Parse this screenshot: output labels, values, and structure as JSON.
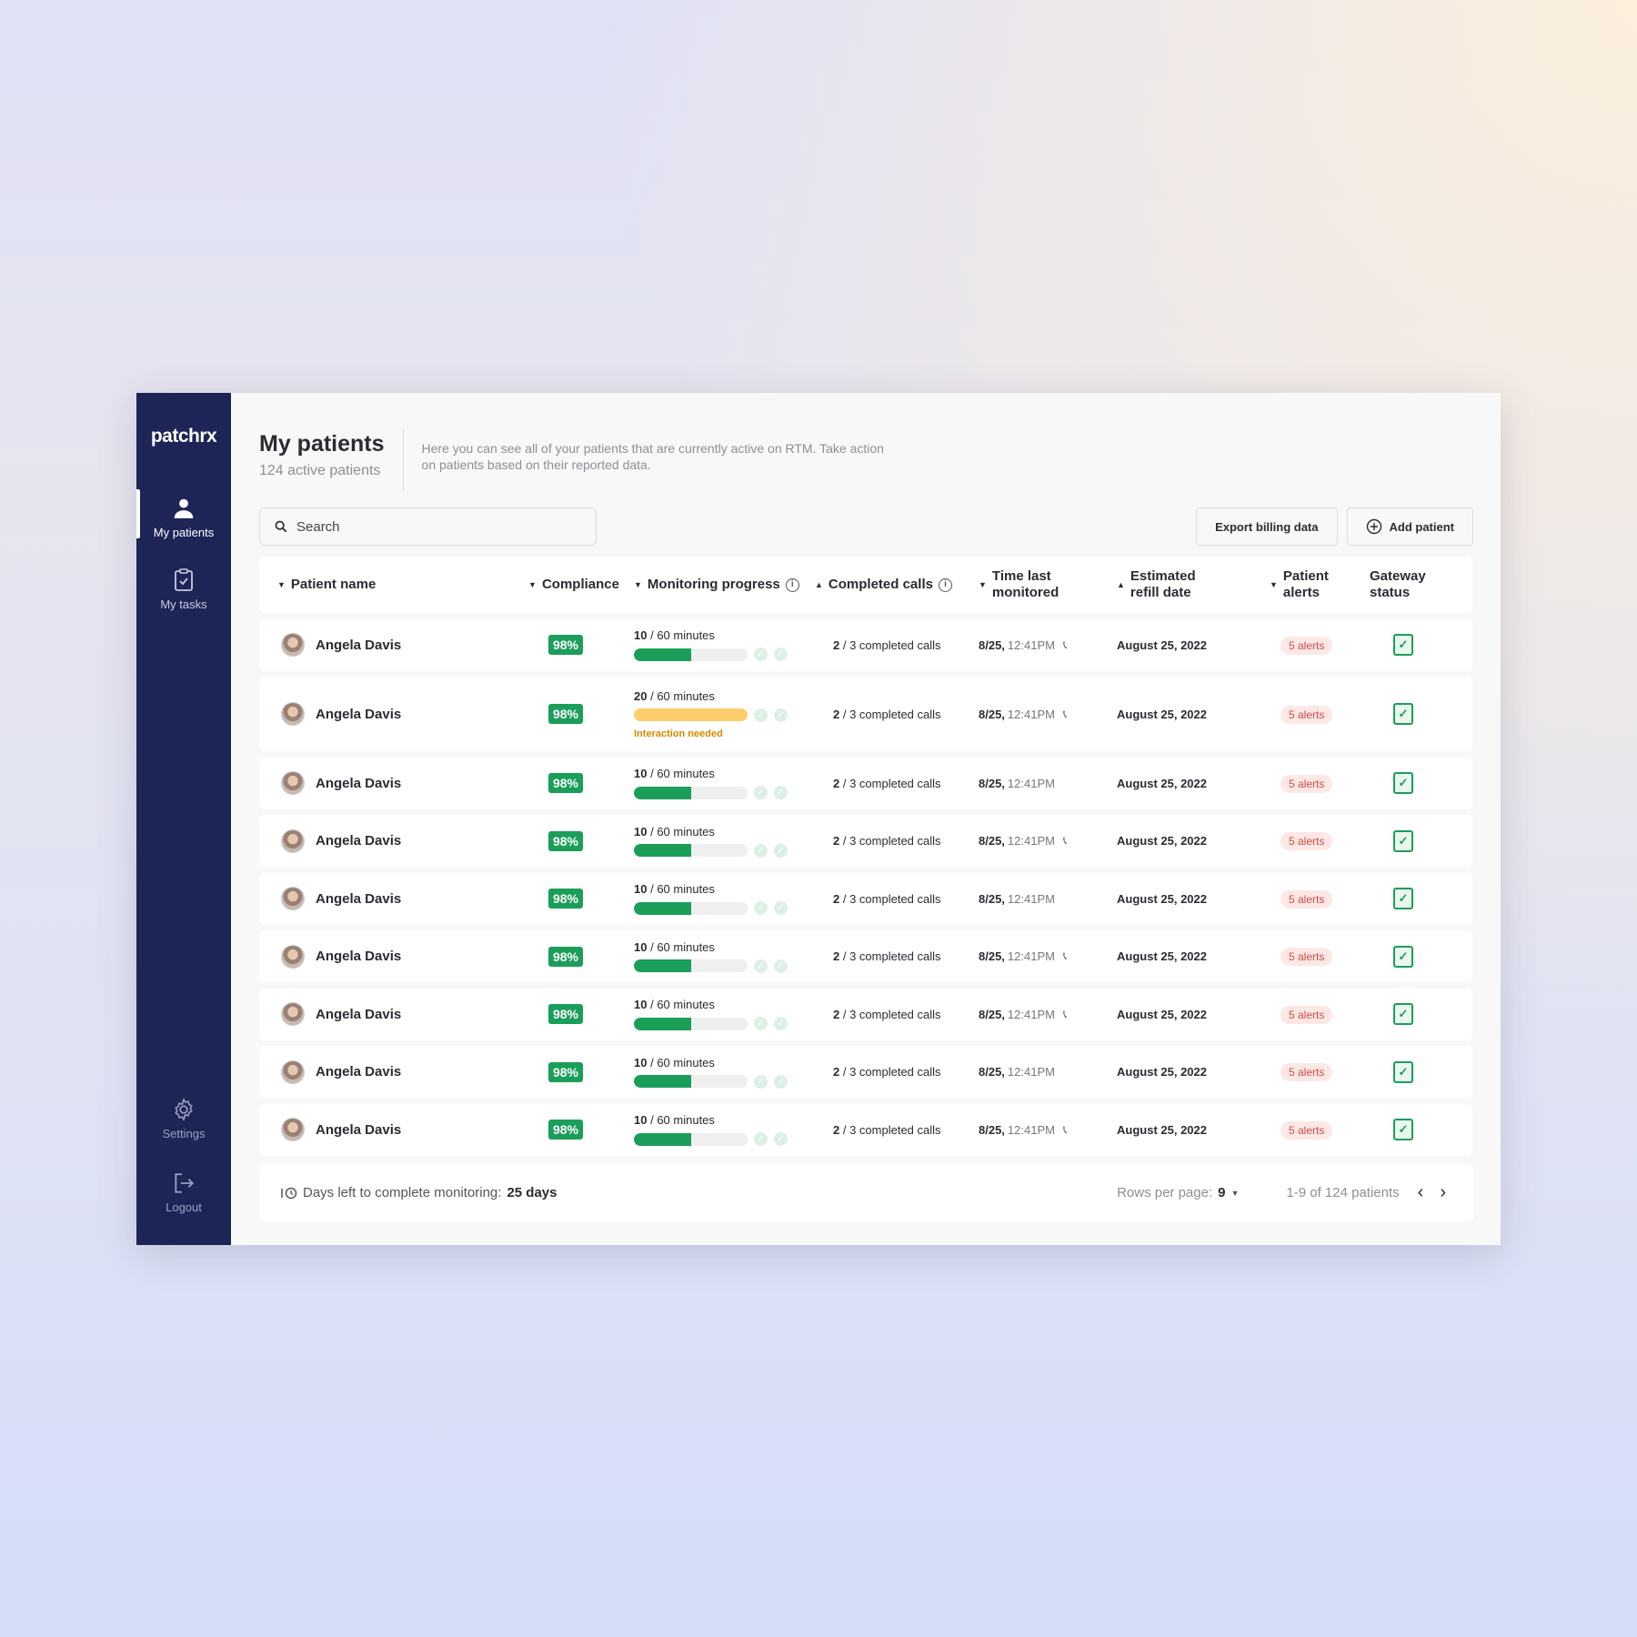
{
  "brand": {
    "logo_text": "patchrx"
  },
  "sidebar": {
    "items": [
      {
        "label": "My patients",
        "icon": "person-icon",
        "active": true
      },
      {
        "label": "My tasks",
        "icon": "clipboard-check-icon",
        "active": false
      }
    ],
    "bottom": [
      {
        "label": "Settings",
        "icon": "gear-icon"
      },
      {
        "label": "Logout",
        "icon": "logout-icon"
      }
    ]
  },
  "header": {
    "title": "My patients",
    "subtitle": "124 active patients",
    "description": "Here you can see all of your patients that are currently active on RTM. Take action on patients based on their reported data."
  },
  "toolbar": {
    "search_placeholder": "Search",
    "export_label": "Export billing data",
    "add_label": "Add patient"
  },
  "columns": [
    "Patient name",
    "Compliance",
    "Monitoring progress",
    "Completed calls",
    "Time last monitored",
    "Estimated refill date",
    "Patient alerts",
    "Gateway status"
  ],
  "rows": [
    {
      "name": "Angela Davis",
      "compliance": "98%",
      "mon_done": "10",
      "mon_total": "/ 60 minutes",
      "progress": 0.5,
      "warning": "",
      "calls_done": "2",
      "calls_text": "/ 3 completed calls",
      "time_date": "8/25,",
      "time_clock": "12:41PM",
      "phone": true,
      "refill": "August 25, 2022",
      "alerts": "5 alerts"
    },
    {
      "name": "Angela Davis",
      "compliance": "98%",
      "mon_done": "20",
      "mon_total": "/ 60 minutes",
      "progress": 1.0,
      "warning": "Interaction needed",
      "calls_done": "2",
      "calls_text": "/ 3 completed calls",
      "time_date": "8/25,",
      "time_clock": "12:41PM",
      "phone": true,
      "refill": "August 25, 2022",
      "alerts": "5 alerts"
    },
    {
      "name": "Angela Davis",
      "compliance": "98%",
      "mon_done": "10",
      "mon_total": "/ 60 minutes",
      "progress": 0.5,
      "warning": "",
      "calls_done": "2",
      "calls_text": "/ 3 completed calls",
      "time_date": "8/25,",
      "time_clock": "12:41PM",
      "phone": false,
      "refill": "August 25, 2022",
      "alerts": "5 alerts"
    },
    {
      "name": "Angela Davis",
      "compliance": "98%",
      "mon_done": "10",
      "mon_total": "/ 60 minutes",
      "progress": 0.5,
      "warning": "",
      "calls_done": "2",
      "calls_text": "/ 3 completed calls",
      "time_date": "8/25,",
      "time_clock": "12:41PM",
      "phone": true,
      "refill": "August 25, 2022",
      "alerts": "5 alerts"
    },
    {
      "name": "Angela Davis",
      "compliance": "98%",
      "mon_done": "10",
      "mon_total": "/ 60 minutes",
      "progress": 0.5,
      "warning": "",
      "calls_done": "2",
      "calls_text": "/ 3 completed calls",
      "time_date": "8/25,",
      "time_clock": "12:41PM",
      "phone": false,
      "refill": "August 25, 2022",
      "alerts": "5 alerts"
    },
    {
      "name": "Angela Davis",
      "compliance": "98%",
      "mon_done": "10",
      "mon_total": "/ 60 minutes",
      "progress": 0.5,
      "warning": "",
      "calls_done": "2",
      "calls_text": "/ 3 completed calls",
      "time_date": "8/25,",
      "time_clock": "12:41PM",
      "phone": true,
      "refill": "August 25, 2022",
      "alerts": "5 alerts"
    },
    {
      "name": "Angela Davis",
      "compliance": "98%",
      "mon_done": "10",
      "mon_total": "/ 60 minutes",
      "progress": 0.5,
      "warning": "",
      "calls_done": "2",
      "calls_text": "/ 3 completed calls",
      "time_date": "8/25,",
      "time_clock": "12:41PM",
      "phone": true,
      "refill": "August 25, 2022",
      "alerts": "5 alerts"
    },
    {
      "name": "Angela Davis",
      "compliance": "98%",
      "mon_done": "10",
      "mon_total": "/ 60 minutes",
      "progress": 0.5,
      "warning": "",
      "calls_done": "2",
      "calls_text": "/ 3 completed calls",
      "time_date": "8/25,",
      "time_clock": "12:41PM",
      "phone": false,
      "refill": "August 25, 2022",
      "alerts": "5 alerts"
    },
    {
      "name": "Angela Davis",
      "compliance": "98%",
      "mon_done": "10",
      "mon_total": "/ 60 minutes",
      "progress": 0.5,
      "warning": "",
      "calls_done": "2",
      "calls_text": "/ 3 completed calls",
      "time_date": "8/25,",
      "time_clock": "12:41PM",
      "phone": true,
      "refill": "August 25, 2022",
      "alerts": "5 alerts"
    }
  ],
  "footer": {
    "days_label": "Days left to complete monitoring:",
    "days_value": "25 days",
    "rows_per_page_label": "Rows per page:",
    "rows_per_page_value": "9",
    "range": "1-9 of 124 patients"
  },
  "colors": {
    "sidebar_bg": "#1d2557",
    "accent_green": "#1b9e5a",
    "warning_yellow": "#ffcd6b",
    "alert_red": "#d04b43"
  }
}
